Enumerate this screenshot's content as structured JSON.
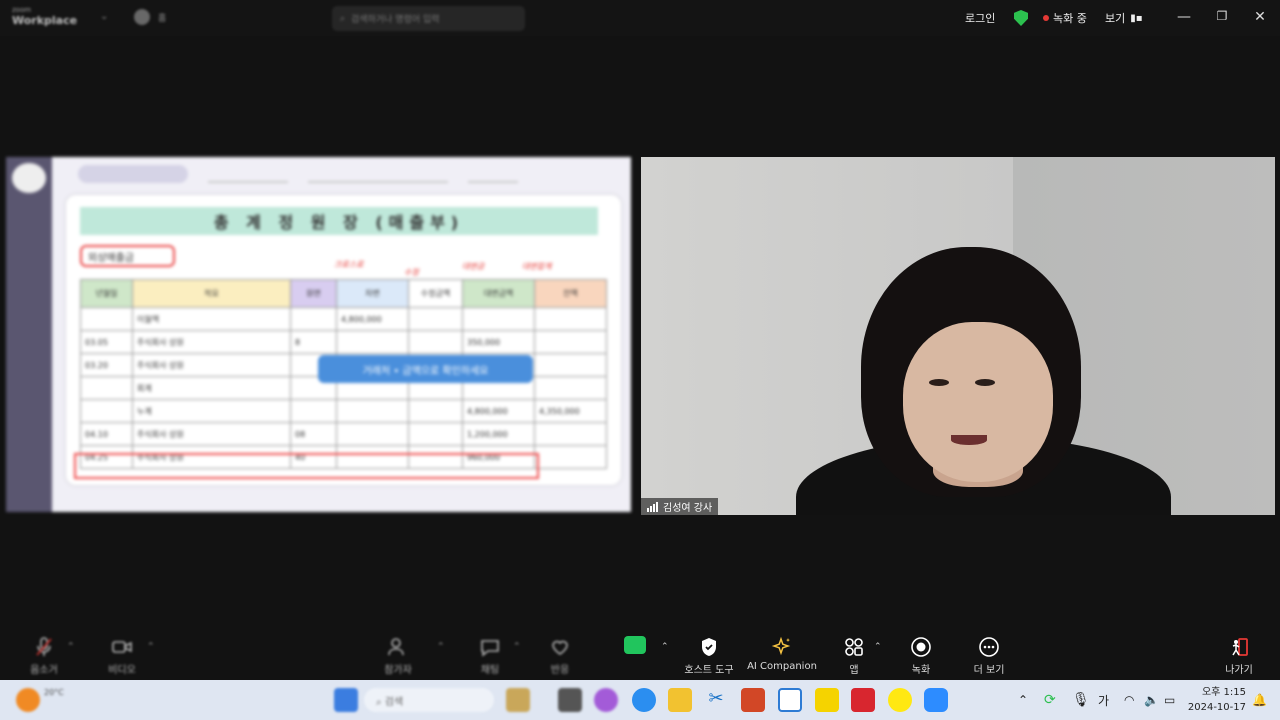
{
  "title_bar": {
    "logo_line1": "zoom",
    "logo_line2": "Workplace",
    "search_placeholder": "검색하거나 명령어 입력",
    "login": "로그인",
    "recording": "녹화 중",
    "view": "보기",
    "accent_green": "#2cc14f",
    "rec_red": "#e53935"
  },
  "shared_screen": {
    "banner": "총 계 정 원 장 (매출부)",
    "account_label": "외상매출금",
    "tip": "거래처 • 금액으로 확인하세요",
    "headers": [
      "년월일",
      "적요",
      "원면",
      "차변",
      "수정금액",
      "대변금액",
      "잔액"
    ],
    "rows": [
      [
        "",
        "이월액",
        "",
        "4,800,000",
        "",
        "",
        ""
      ],
      [
        "03.05",
        "주식회사 상원",
        "8",
        "",
        "",
        "350,000",
        ""
      ],
      [
        "03.20",
        "주식회사 상원",
        "",
        "",
        "",
        "",
        ""
      ],
      [
        "",
        "회계",
        "",
        "",
        "",
        "",
        ""
      ],
      [
        "",
        "누계",
        "",
        "",
        "",
        "4,800,000",
        "4,350,000"
      ],
      [
        "04.10",
        "주식회사 상원",
        "08",
        "",
        "",
        "1,200,000",
        ""
      ],
      [
        "04.25",
        "주식회사 상원",
        "40",
        "",
        "",
        "960,000",
        ""
      ]
    ],
    "annotations": [
      "크로스로",
      "수정",
      "대변금",
      "대변합계"
    ]
  },
  "video": {
    "participant_name": "김성여 강사"
  },
  "controls": {
    "blurred": [
      {
        "label": "음소거"
      },
      {
        "label": "비디오"
      },
      {
        "label": "참가자"
      },
      {
        "label": "채팅"
      },
      {
        "label": "반응"
      }
    ],
    "items": [
      {
        "label": "호스트 도구",
        "icon": "shield-icon"
      },
      {
        "label": "AI Companion",
        "icon": "sparkle-icon"
      },
      {
        "label": "앱",
        "icon": "apps-icon"
      },
      {
        "label": "녹화",
        "icon": "record-icon"
      },
      {
        "label": "더 보기",
        "icon": "more-icon"
      }
    ],
    "leave": "나가기",
    "share_color": "#21c55d",
    "ai_color": "#f5c242",
    "leave_color": "#e53935"
  },
  "taskbar": {
    "weather": "20°C",
    "search_placeholder": "검색",
    "ime": "가",
    "time": "오후 1:15",
    "date": "2024-10-17"
  }
}
